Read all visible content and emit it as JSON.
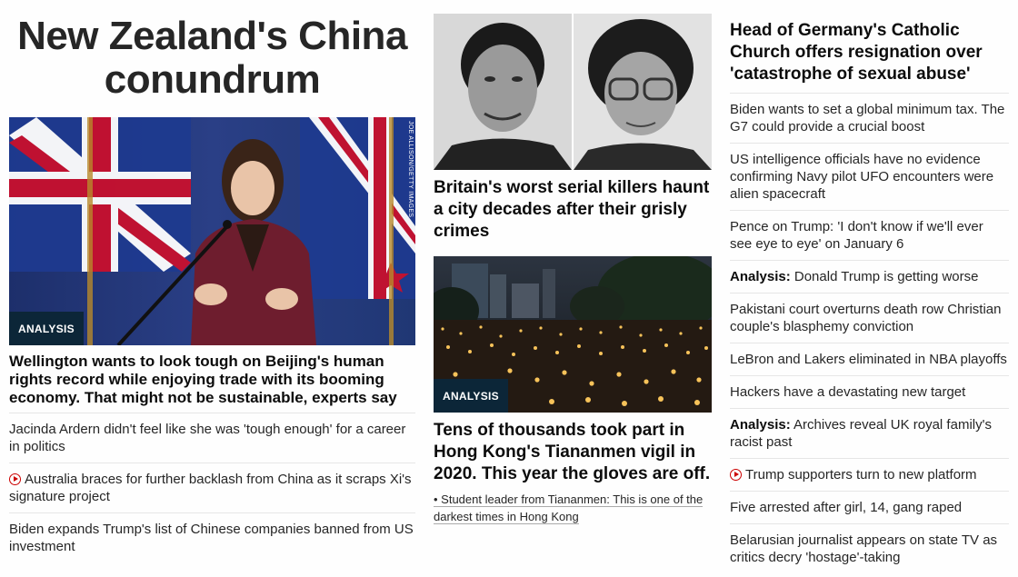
{
  "left": {
    "headline": "New Zealand's China conundrum",
    "image_badge": "ANALYSIS",
    "image_credit": "JOE ALLISON/GETTY IMAGES",
    "lead_title": "Wellington wants to look tough on Beijing's human rights record while enjoying trade with its booming economy. That might not be sustainable, experts say",
    "items": [
      {
        "text": "Jacinda Ardern didn't feel like she was 'tough enough' for a career in politics"
      },
      {
        "text": "Australia braces for further backlash from China as it scraps Xi's signature project",
        "icon": "play-icon"
      },
      {
        "text": "Biden expands Trump's list of Chinese companies banned from US investment"
      }
    ]
  },
  "middle": {
    "story1_title": "Britain's worst serial killers haunt a city decades after their grisly crimes",
    "story2_badge": "ANALYSIS",
    "story2_title": "Tens of thousands took part in Hong Kong's Tiananmen vigil in 2020. This year the gloves are off.",
    "story2_sublink": "• Student leader from Tiananmen: This is one of the darkest times in Hong Kong"
  },
  "right": {
    "lead_title": "Head of Germany's Catholic Church offers resignation over 'catastrophe of sexual abuse'",
    "items": [
      {
        "prefix": "",
        "text": "Biden wants to set a global minimum tax. The G7 could provide a crucial boost"
      },
      {
        "prefix": "",
        "text": "US intelligence officials have no evidence confirming Navy pilot UFO encounters were alien spacecraft"
      },
      {
        "prefix": "",
        "text": "Pence on Trump: 'I don't know if we'll ever see eye to eye' on January 6"
      },
      {
        "prefix": "Analysis:",
        "text": " Donald Trump is getting worse"
      },
      {
        "prefix": "",
        "text": "Pakistani court overturns death row Christian couple's blasphemy conviction"
      },
      {
        "prefix": "",
        "text": "LeBron and Lakers eliminated in NBA playoffs"
      },
      {
        "prefix": "",
        "text": "Hackers have a devastating new target"
      },
      {
        "prefix": "Analysis:",
        "text": " Archives reveal UK royal family's racist past"
      },
      {
        "prefix": "",
        "text": "Trump supporters turn to new platform",
        "icon": "play-icon"
      },
      {
        "prefix": "",
        "text": "Five arrested after girl, 14, gang raped"
      },
      {
        "prefix": "",
        "text": "Belarusian journalist appears on state TV as critics decry 'hostage'-taking"
      }
    ]
  }
}
